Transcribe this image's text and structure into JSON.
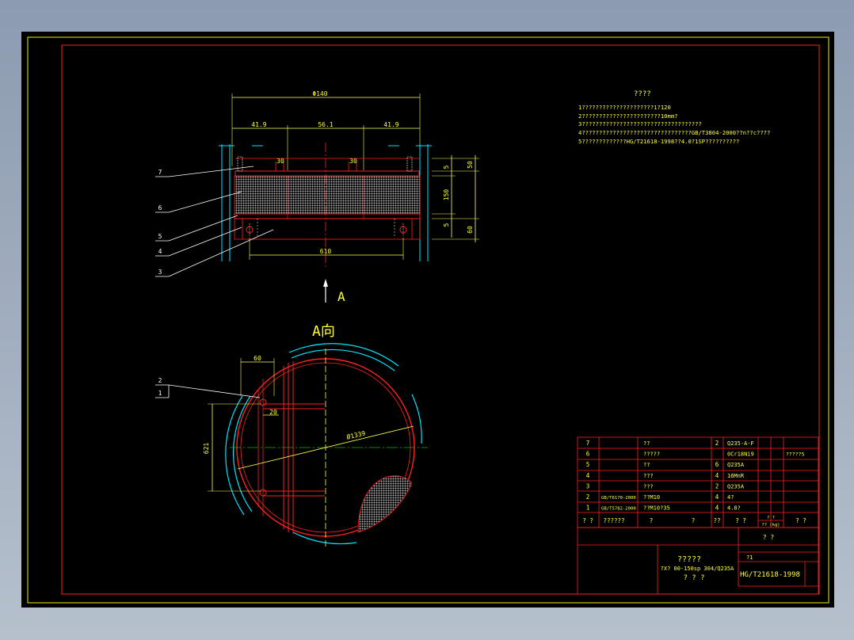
{
  "colors": {
    "background": "#000000",
    "frame": "#c8c800",
    "border": "#ff2020",
    "dim": "#ffff55",
    "text_yellow": "#ffff33",
    "cyan": "#00e5ff",
    "white": "#ffffff",
    "green": "#00c000",
    "hatch": "#b8b8b8",
    "outer": "#8c9bb0"
  },
  "elevation": {
    "dims": {
      "overall": "Φ140",
      "left": "41.9",
      "middle": "56.1",
      "right": "41.9",
      "slot_left": "30",
      "slot_right": "30",
      "top_gap": "50",
      "h1": "5",
      "h2": "150",
      "h3": "5",
      "h4": "60",
      "bottom": "610"
    },
    "balloons": [
      "7",
      "6",
      "5",
      "4",
      "3"
    ]
  },
  "direction_arrow_label": "A",
  "plan": {
    "title": "A向",
    "dims": {
      "d60": "60",
      "d20": "20",
      "d621": "621",
      "diameter": "Ø1339"
    },
    "balloon": {
      "number": "2",
      "sub": "1"
    }
  },
  "notes": {
    "title": "????",
    "lines": [
      "1?????????????????????1?120",
      "2???????????????????????10mm?",
      "3???????????????????????????????????",
      "4????????????????????????????????GB/T3804-2000??n??c????",
      "5?????????????HG/T21618-1998??4.0?1SP??????????"
    ]
  },
  "bom": {
    "rows": [
      {
        "no": "7",
        "std": "",
        "name": "??",
        "qty": "2",
        "material": "Q235-A·F",
        "note": ""
      },
      {
        "no": "6",
        "std": "",
        "name": "?????",
        "qty": "",
        "material": "0Cr18Ni9",
        "note": "?????5"
      },
      {
        "no": "5",
        "std": "",
        "name": "??",
        "qty": "6",
        "material": "Q235A",
        "note": ""
      },
      {
        "no": "4",
        "std": "",
        "name": "???",
        "qty": "4",
        "material": "16MnR",
        "note": ""
      },
      {
        "no": "3",
        "std": "",
        "name": "???",
        "qty": "2",
        "material": "Q235A",
        "note": ""
      },
      {
        "no": "2",
        "std": "GB/T6170-2000",
        "name": "??M10",
        "qty": "4",
        "material": "4?",
        "note": ""
      },
      {
        "no": "1",
        "std": "GB/T5782-2000",
        "name": "??M10?35",
        "qty": "4",
        "material": "4.8?",
        "note": ""
      }
    ],
    "header": {
      "no": "? ?",
      "std": "??????",
      "name": "?",
      "name2": "?",
      "qty": "??",
      "material": "? ?",
      "weight_top": "? ?",
      "weight_bot": "?? (kg)",
      "note": "? ?"
    }
  },
  "title_block": {
    "top_right": "? ?",
    "small_label": "?1",
    "drawing_title": "?????",
    "subtitle": "?X? 00-150sp 304/Q235A",
    "subtitle2": "? ? ?",
    "standard": "HG/T21618-1998"
  }
}
